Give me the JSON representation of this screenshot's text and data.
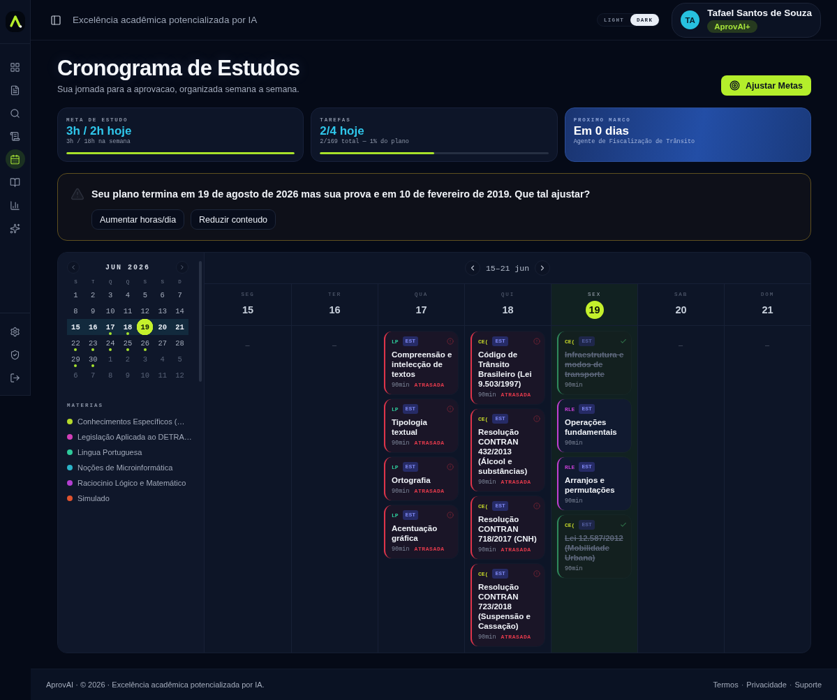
{
  "sidebar": {
    "items": [
      {
        "selected": false
      },
      {
        "selected": false
      },
      {
        "selected": false
      },
      {
        "selected": false
      },
      {
        "selected": true
      },
      {
        "selected": false
      },
      {
        "selected": false
      },
      {
        "selected": false
      }
    ]
  },
  "header": {
    "tagline": "Excelência acadêmica potencializada por IA",
    "theme_options": [
      {
        "label": "LIGHT",
        "selected": false
      },
      {
        "label": "DARK",
        "selected": true
      }
    ],
    "user": {
      "initials": "TA",
      "name": "Tafael Santos de Souza",
      "plan": "AprovAI+"
    }
  },
  "page": {
    "title": "Cronograma de Estudos",
    "subtitle": "Sua jornada para a aprovacao, organizada semana a semana.",
    "action": "Ajustar Metas"
  },
  "stats": [
    {
      "kind": "progress",
      "label": "META DE ESTUDO",
      "value": "3h / 2h hoje",
      "detail": "3h / 18h na semana",
      "level": 1
    },
    {
      "kind": "progress",
      "label": "TAREFAS",
      "value": "2/4 hoje",
      "detail": "2/169 total — 1% do plano",
      "level": 0.5
    },
    {
      "kind": "milestone",
      "label": "PROXIMO MARCO",
      "value": "Em 0 dias",
      "detail": "Agente de Fiscalização de Trânsito"
    }
  ],
  "alert": {
    "message": "Seu plano termina em 19 de agosto de 2026 mas sua prova e em 10 de fevereiro de 2019. Que tal ajustar?",
    "actions": [
      "Aumentar horas/dia",
      "Reduzir conteudo"
    ]
  },
  "mini_calendar": {
    "month": "JUN 2026",
    "weekdays": [
      "S",
      "T",
      "Q",
      "Q",
      "S",
      "S",
      "D"
    ],
    "days": [
      {
        "label": "1",
        "muted": false,
        "in_week": false,
        "selected": false,
        "dot": false
      },
      {
        "label": "2",
        "muted": false,
        "in_week": false,
        "selected": false,
        "dot": false
      },
      {
        "label": "3",
        "muted": false,
        "in_week": false,
        "selected": false,
        "dot": false
      },
      {
        "label": "4",
        "muted": false,
        "in_week": false,
        "selected": false,
        "dot": false
      },
      {
        "label": "5",
        "muted": false,
        "in_week": false,
        "selected": false,
        "dot": false
      },
      {
        "label": "6",
        "muted": false,
        "in_week": false,
        "selected": false,
        "dot": false
      },
      {
        "label": "7",
        "muted": false,
        "in_week": false,
        "selected": false,
        "dot": false
      },
      {
        "label": "8",
        "muted": false,
        "in_week": false,
        "selected": false,
        "dot": false
      },
      {
        "label": "9",
        "muted": false,
        "in_week": false,
        "selected": false,
        "dot": false
      },
      {
        "label": "10",
        "muted": false,
        "in_week": false,
        "selected": false,
        "dot": false
      },
      {
        "label": "11",
        "muted": false,
        "in_week": false,
        "selected": false,
        "dot": false
      },
      {
        "label": "12",
        "muted": false,
        "in_week": false,
        "selected": false,
        "dot": false
      },
      {
        "label": "13",
        "muted": false,
        "in_week": false,
        "selected": false,
        "dot": false
      },
      {
        "label": "14",
        "muted": false,
        "in_week": false,
        "selected": false,
        "dot": false
      },
      {
        "label": "15",
        "muted": false,
        "in_week": true,
        "selected": false,
        "dot": false
      },
      {
        "label": "16",
        "muted": false,
        "in_week": true,
        "selected": false,
        "dot": false
      },
      {
        "label": "17",
        "muted": false,
        "in_week": true,
        "selected": false,
        "dot": true
      },
      {
        "label": "18",
        "muted": false,
        "in_week": true,
        "selected": false,
        "dot": true
      },
      {
        "label": "19",
        "muted": false,
        "in_week": true,
        "selected": true,
        "dot": false
      },
      {
        "label": "20",
        "muted": false,
        "in_week": true,
        "selected": false,
        "dot": false
      },
      {
        "label": "21",
        "muted": false,
        "in_week": true,
        "selected": false,
        "dot": false
      },
      {
        "label": "22",
        "muted": false,
        "in_week": false,
        "selected": false,
        "dot": true
      },
      {
        "label": "23",
        "muted": false,
        "in_week": false,
        "selected": false,
        "dot": true
      },
      {
        "label": "24",
        "muted": false,
        "in_week": false,
        "selected": false,
        "dot": true
      },
      {
        "label": "25",
        "muted": false,
        "in_week": false,
        "selected": false,
        "dot": true
      },
      {
        "label": "26",
        "muted": false,
        "in_week": false,
        "selected": false,
        "dot": true
      },
      {
        "label": "27",
        "muted": false,
        "in_week": false,
        "selected": false,
        "dot": false
      },
      {
        "label": "28",
        "muted": false,
        "in_week": false,
        "selected": false,
        "dot": false
      },
      {
        "label": "29",
        "muted": false,
        "in_week": false,
        "selected": false,
        "dot": true
      },
      {
        "label": "30",
        "muted": false,
        "in_week": false,
        "selected": false,
        "dot": true
      },
      {
        "label": "1",
        "muted": true,
        "in_week": false,
        "selected": false,
        "dot": false
      },
      {
        "label": "2",
        "muted": true,
        "in_week": false,
        "selected": false,
        "dot": false
      },
      {
        "label": "3",
        "muted": true,
        "in_week": false,
        "selected": false,
        "dot": false
      },
      {
        "label": "4",
        "muted": true,
        "in_week": false,
        "selected": false,
        "dot": false
      },
      {
        "label": "5",
        "muted": true,
        "in_week": false,
        "selected": false,
        "dot": false
      },
      {
        "label": "6",
        "muted": true,
        "in_week": false,
        "selected": false,
        "dot": false
      },
      {
        "label": "7",
        "muted": true,
        "in_week": false,
        "selected": false,
        "dot": false
      },
      {
        "label": "8",
        "muted": true,
        "in_week": false,
        "selected": false,
        "dot": false
      },
      {
        "label": "9",
        "muted": true,
        "in_week": false,
        "selected": false,
        "dot": false
      },
      {
        "label": "10",
        "muted": true,
        "in_week": false,
        "selected": false,
        "dot": false
      },
      {
        "label": "11",
        "muted": true,
        "in_week": false,
        "selected": false,
        "dot": false
      },
      {
        "label": "12",
        "muted": true,
        "in_week": false,
        "selected": false,
        "dot": false
      }
    ]
  },
  "subjects": {
    "title": "MATERIAS",
    "items": [
      {
        "name": "Conhecimentos Específicos (…",
        "color": "#b5d92b"
      },
      {
        "name": "Legislação Aplicada ao DETRA…",
        "color": "#d23fb8"
      },
      {
        "name": "Lingua Portuguesa",
        "color": "#2ec99a"
      },
      {
        "name": "Noções de Microinformática",
        "color": "#2bb3c8"
      },
      {
        "name": "Raciocinio Lógico e Matemático",
        "color": "#b33fd1"
      },
      {
        "name": "Simulado",
        "color": "#e0532e"
      }
    ]
  },
  "week": {
    "range": "15–21 jun",
    "days": [
      {
        "weekday": "SEG",
        "date": "15",
        "today": false,
        "empty": "–"
      },
      {
        "weekday": "TER",
        "date": "16",
        "today": false,
        "empty": "–"
      },
      {
        "weekday": "QUA",
        "date": "17",
        "today": false,
        "tasks": [
          {
            "tag": "LP",
            "color": "#2ec99a",
            "type": "EST",
            "title": "Compreensão e intelecção de textos",
            "duration": "90min",
            "overdue": true,
            "done": false,
            "status_label": "ATRASADA"
          },
          {
            "tag": "LP",
            "color": "#2ec99a",
            "type": "EST",
            "title": "Tipologia textual",
            "duration": "90min",
            "overdue": true,
            "done": false,
            "status_label": "ATRASADA"
          },
          {
            "tag": "LP",
            "color": "#2ec99a",
            "type": "EST",
            "title": "Ortografia",
            "duration": "90min",
            "overdue": true,
            "done": false,
            "status_label": "ATRASADA"
          },
          {
            "tag": "LP",
            "color": "#2ec99a",
            "type": "EST",
            "title": "Acentuação gráfica",
            "duration": "90min",
            "overdue": true,
            "done": false,
            "status_label": "ATRASADA"
          }
        ]
      },
      {
        "weekday": "QUI",
        "date": "18",
        "today": false,
        "tasks": [
          {
            "tag": "CE(",
            "color": "#c5d62a",
            "type": "EST",
            "title": "Código de Trânsito Brasileiro (Lei 9.503/1997)",
            "duration": "90min",
            "overdue": true,
            "done": false,
            "status_label": "ATRASADA"
          },
          {
            "tag": "CE(",
            "color": "#c5d62a",
            "type": "EST",
            "title": "Resolução CONTRAN 432/2013 (Álcool e substâncias)",
            "duration": "90min",
            "overdue": true,
            "done": false,
            "status_label": "ATRASADA"
          },
          {
            "tag": "CE(",
            "color": "#c5d62a",
            "type": "EST",
            "title": "Resolução CONTRAN 718/2017 (CNH)",
            "duration": "90min",
            "overdue": true,
            "done": false,
            "status_label": "ATRASADA"
          },
          {
            "tag": "CE(",
            "color": "#c5d62a",
            "type": "EST",
            "title": "Resolução CONTRAN 723/2018 (Suspensão e Cassação)",
            "duration": "90min",
            "overdue": true,
            "done": false,
            "status_label": "ATRASADA"
          }
        ]
      },
      {
        "weekday": "SEX",
        "date": "19",
        "today": true,
        "tasks": [
          {
            "tag": "CE(",
            "color": "#c5d62a",
            "type": "EST",
            "title": "Infraestrutura e modos de transporte",
            "duration": "90min",
            "overdue": false,
            "done": true
          },
          {
            "tag": "RLE",
            "color": "#c03fd0",
            "type": "EST",
            "title": "Operações fundamentais",
            "duration": "90min",
            "overdue": false,
            "done": false
          },
          {
            "tag": "RLE",
            "color": "#c03fd0",
            "type": "EST",
            "title": "Arranjos e permutações",
            "duration": "90min",
            "overdue": false,
            "done": false
          },
          {
            "tag": "CE(",
            "color": "#c5d62a",
            "type": "EST",
            "title": "Lei 12.587/2012 (Mobilidade Urbana)",
            "duration": "90min",
            "overdue": false,
            "done": true
          }
        ]
      },
      {
        "weekday": "SAB",
        "date": "20",
        "today": false,
        "empty": "–"
      },
      {
        "weekday": "DOM",
        "date": "21",
        "today": false,
        "empty": "–"
      }
    ]
  },
  "footer": {
    "text": "AprovAI · © 2026 · Excelência acadêmica potencializada por IA.",
    "links": [
      "Termos",
      "Privacidade",
      "Suporte"
    ],
    "separator": "·"
  }
}
